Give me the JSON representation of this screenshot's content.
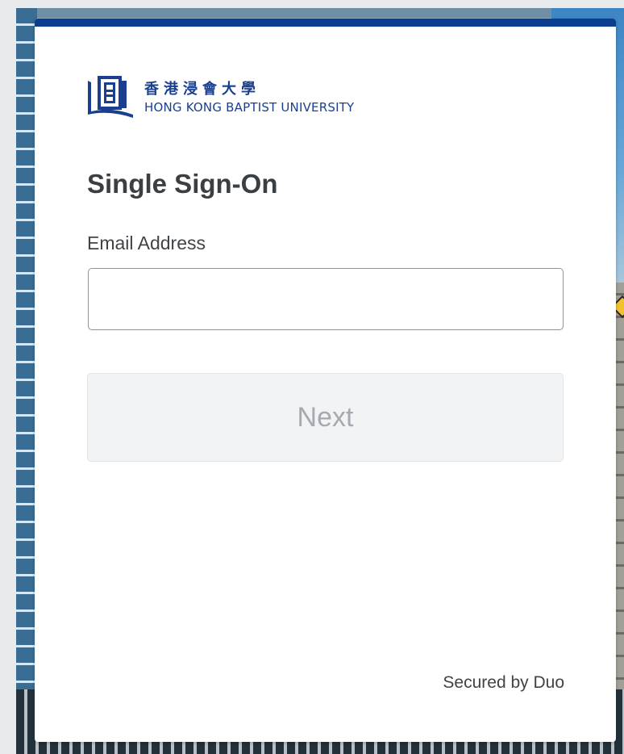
{
  "logo": {
    "name_zh": "香港浸會大學",
    "name_en": "HONG KONG BAPTIST UNIVERSITY",
    "icon": "hkbu-logo-icon"
  },
  "login": {
    "title": "Single Sign-On",
    "email_label": "Email Address",
    "email_value": "",
    "email_placeholder": "",
    "next_label": "Next"
  },
  "footer": {
    "secured_text": "Secured by Duo"
  },
  "colors": {
    "accent": "#0b3d91",
    "logo_blue": "#1a3f8f",
    "disabled_button_bg": "#f2f3f4",
    "disabled_button_text": "#a6aab0"
  }
}
